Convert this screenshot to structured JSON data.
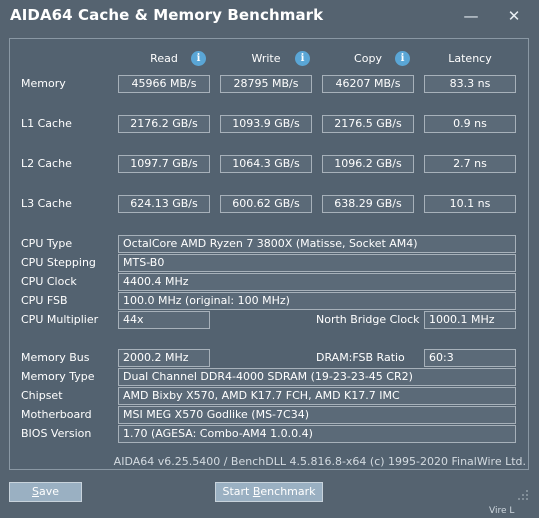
{
  "window": {
    "title": "AIDA64 Cache & Memory Benchmark",
    "minimize_glyph": "—",
    "close_glyph": "✕"
  },
  "columns": {
    "read": "Read",
    "write": "Write",
    "copy": "Copy",
    "latency": "Latency",
    "info_glyph": "i"
  },
  "bench": {
    "memory": {
      "label": "Memory",
      "read": "45966 MB/s",
      "write": "28795 MB/s",
      "copy": "46207 MB/s",
      "latency": "83.3 ns"
    },
    "l1": {
      "label": "L1 Cache",
      "read": "2176.2 GB/s",
      "write": "1093.9 GB/s",
      "copy": "2176.5 GB/s",
      "latency": "0.9 ns"
    },
    "l2": {
      "label": "L2 Cache",
      "read": "1097.7 GB/s",
      "write": "1064.3 GB/s",
      "copy": "1096.2 GB/s",
      "latency": "2.7 ns"
    },
    "l3": {
      "label": "L3 Cache",
      "read": "624.13 GB/s",
      "write": "600.62 GB/s",
      "copy": "638.29 GB/s",
      "latency": "10.1 ns"
    }
  },
  "cpu": {
    "type_label": "CPU Type",
    "type": "OctalCore AMD Ryzen 7 3800X  (Matisse, Socket AM4)",
    "stepping_label": "CPU Stepping",
    "stepping": "MTS-B0",
    "clock_label": "CPU Clock",
    "clock": "4400.4 MHz",
    "fsb_label": "CPU FSB",
    "fsb": "100.0 MHz  (original: 100 MHz)",
    "multiplier_label": "CPU Multiplier",
    "multiplier": "44x",
    "nb_clock_label": "North Bridge Clock",
    "nb_clock": "1000.1 MHz"
  },
  "mem": {
    "bus_label": "Memory Bus",
    "bus": "2000.2 MHz",
    "ratio_label": "DRAM:FSB Ratio",
    "ratio": "60:3",
    "type_label": "Memory Type",
    "type": "Dual Channel DDR4-4000 SDRAM  (19-23-23-45 CR2)",
    "chipset_label": "Chipset",
    "chipset": "AMD Bixby X570, AMD K17.7 FCH, AMD K17.7 IMC",
    "motherboard_label": "Motherboard",
    "motherboard": "MSI MEG X570 Godlike (MS-7C34)",
    "bios_label": "BIOS Version",
    "bios": "1.70  (AGESA: Combo-AM4 1.0.0.4)"
  },
  "footer": "AIDA64 v6.25.5400 / BenchDLL 4.5.816.8-x64  (c) 1995-2020 FinalWire Ltd.",
  "buttons": {
    "save_first": "S",
    "save_rest": "ave",
    "start_pre": "Start ",
    "start_u": "B",
    "start_post": "enchmark"
  },
  "corner_text": "Vire L"
}
